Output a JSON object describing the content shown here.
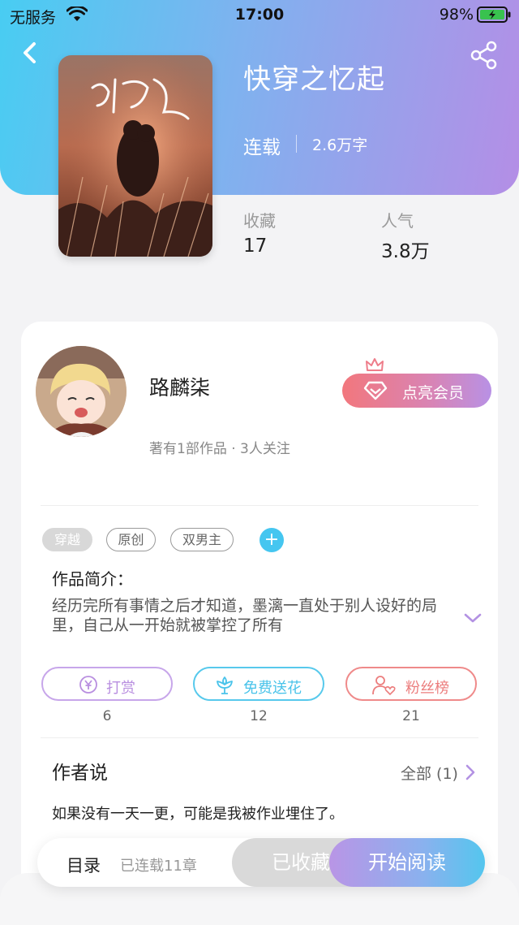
{
  "status_bar": {
    "carrier": "无服务",
    "time": "17:00",
    "battery": "98%"
  },
  "book": {
    "title": "快穿之忆起",
    "status": "连载",
    "word_count": "2.6万字",
    "cover_icon": "book-cover-image",
    "stats": [
      {
        "label": "收藏",
        "value": "17"
      },
      {
        "label": "人气",
        "value": "3.8万"
      }
    ]
  },
  "author": {
    "name": "路麟柒",
    "meta": "著有1部作品 · 3人关注",
    "vip_label": "点亮会员"
  },
  "tags": [
    "穿越",
    "原创",
    "双男主"
  ],
  "intro": {
    "title": "作品简介：",
    "text": "经历完所有事情之后才知道，墨漓一直处于别人设好的局里，自己从一开始就被掌控了所有"
  },
  "actions": [
    {
      "label": "打赏",
      "count": "6",
      "icon": "yen-coin-icon",
      "color": "#b98fe0"
    },
    {
      "label": "免费送花",
      "count": "12",
      "icon": "flower-icon",
      "color": "#49c3ea"
    },
    {
      "label": "粉丝榜",
      "count": "21",
      "icon": "fan-user-icon",
      "color": "#ec7d7d"
    }
  ],
  "author_say": {
    "title": "作者说",
    "all_label": "全部 (1)",
    "text": "如果没有一天一更，可能是我被作业埋住了。"
  },
  "bottom_bar": {
    "toc": "目录",
    "chapters": "已连载11章",
    "collected": "已收藏",
    "read": "开始阅读"
  },
  "colors": {
    "header_start": "#48cdf2",
    "header_end": "#b48ee6",
    "accent_blue": "#45c6f0",
    "accent_purple": "#b98fe0"
  }
}
